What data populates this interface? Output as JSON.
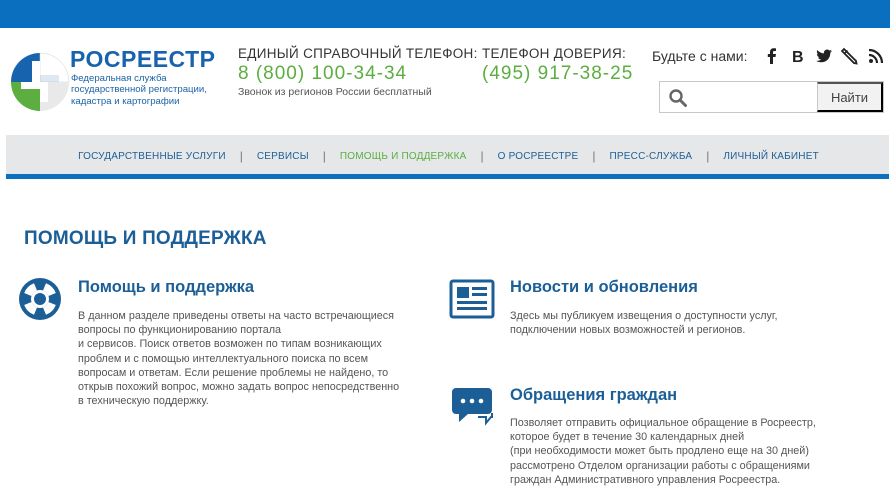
{
  "header": {
    "logo": {
      "title": "РОСРЕЕСТР",
      "subtitle_lines": [
        "Федеральная служба",
        "государственной регистрации,",
        "кадастра и картографии"
      ]
    },
    "phone_main": {
      "label": "ЕДИНЫЙ СПРАВОЧНЫЙ ТЕЛЕФОН:",
      "number": "8 (800) 100-34-34",
      "note": "Звонок из регионов России бесплатный"
    },
    "phone_trust": {
      "label": "ТЕЛЕФОН ДОВЕРИЯ:",
      "number": "(495) 917-38-25"
    },
    "social": {
      "label": "Будьте с нами:",
      "icons": [
        "facebook-icon",
        "vk-icon",
        "twitter-icon",
        "livejournal-icon",
        "rss-icon"
      ]
    },
    "search": {
      "value": "",
      "placeholder": "",
      "button_label": "Найти"
    }
  },
  "nav": {
    "items": [
      {
        "label": "ГОСУДАРСТВЕННЫЕ УСЛУГИ",
        "active": false
      },
      {
        "label": "СЕРВИСЫ",
        "active": false
      },
      {
        "label": "ПОМОЩЬ И ПОДДЕРЖКА",
        "active": true
      },
      {
        "label": "О РОСРЕЕСТРЕ",
        "active": false
      },
      {
        "label": "ПРЕСС-СЛУЖБА",
        "active": false
      },
      {
        "label": "ЛИЧНЫЙ КАБИНЕТ",
        "active": false
      }
    ],
    "separator": "|"
  },
  "main": {
    "title": "ПОМОЩЬ И ПОДДЕРЖКА",
    "cards": [
      {
        "icon": "lifebuoy-icon",
        "title": "Помощь и поддержка",
        "text_lines": [
          "В данном разделе приведены ответы на часто встречающиеся",
          "вопросы по функционированию портала",
          "и сервисов. Поиск ответов возможен по типам возникающих",
          "проблем и с помощью интеллектуального поиска по всем",
          "вопросам и ответам. Если решение проблемы не найдено, то",
          "открыв похожий вопрос, можно задать вопрос непосредственно",
          "в техническую поддержку."
        ]
      },
      {
        "icon": "newspaper-icon",
        "title": "Новости и обновления",
        "text_lines": [
          "Здесь мы публикуем извещения о доступности услуг,",
          "подключении новых возможностей и регионов."
        ]
      },
      {
        "icon": "chat-bubbles-icon",
        "title": "Обращения граждан",
        "text_lines": [
          "Позволяет отправить официальное обращение в Росреестр,",
          "которое будет в течение 30 календарных дней",
          "(при необходимости может быть продлено еще на 30 дней)",
          "рассмотрено Отделом организации работы с обращениями",
          "граждан Административного управления Росреестра."
        ]
      }
    ]
  },
  "colors": {
    "brand_blue": "#0a6fbf",
    "title_blue": "#1c5f97",
    "accent_green": "#5cae40",
    "nav_bg": "#e6e7e8"
  }
}
